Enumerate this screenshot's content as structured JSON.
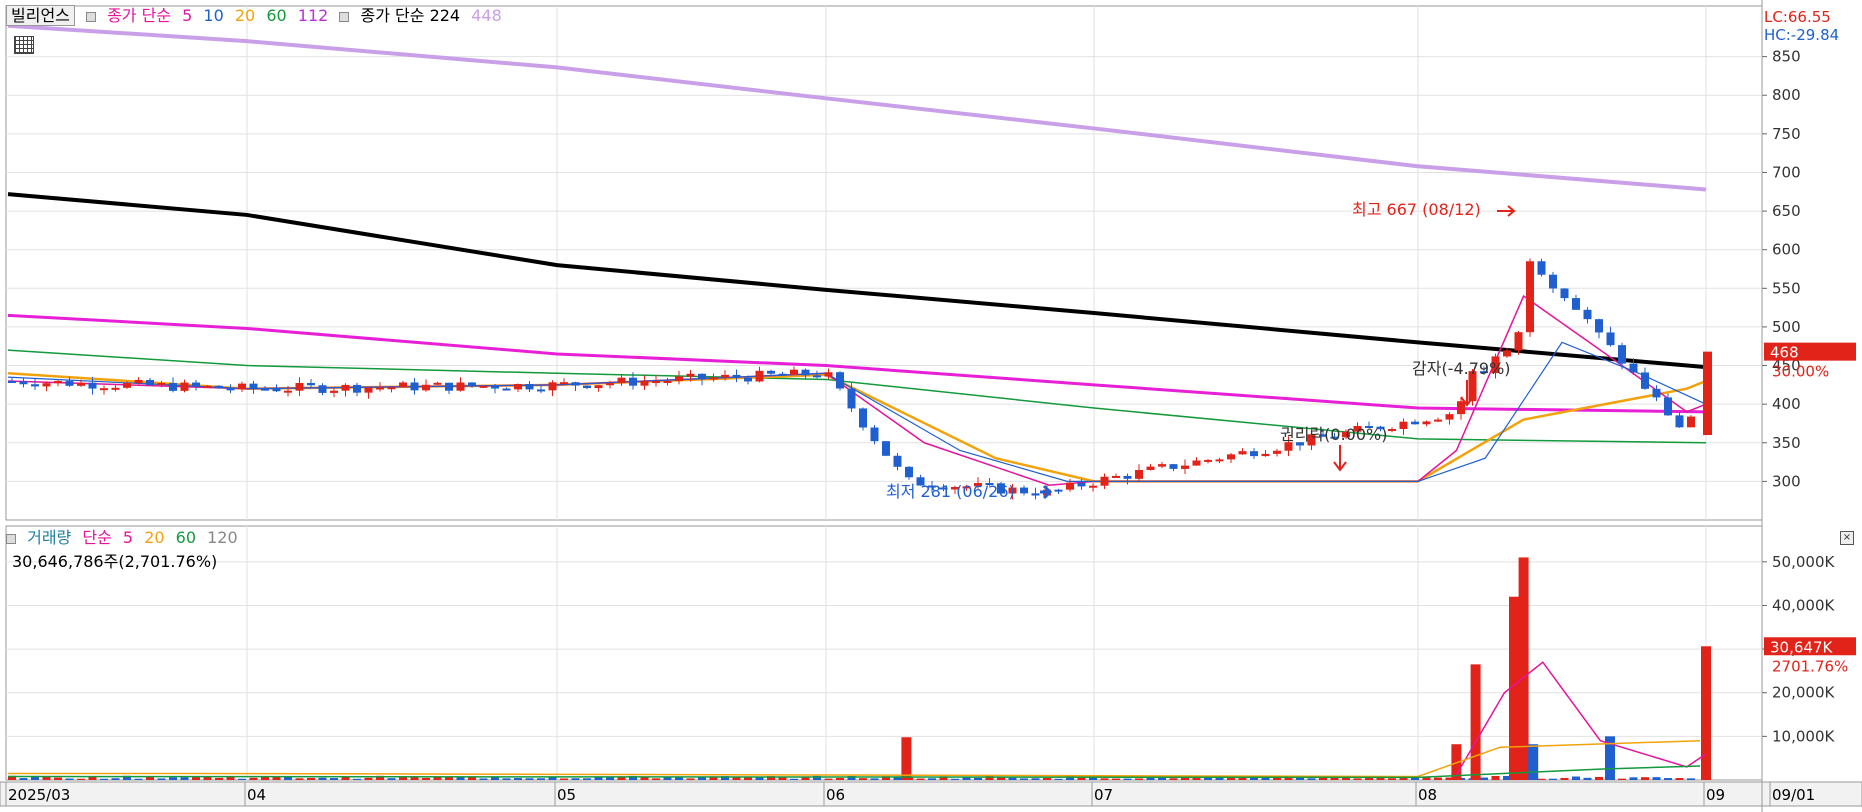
{
  "price_legend": {
    "tab": "빌리언스",
    "ma_title": "종가 단순",
    "ma_periods": [
      "5",
      "10",
      "20",
      "60",
      "112"
    ],
    "ma_colors": [
      "#e6149c",
      "#1f5fd0",
      "#f2a20c",
      "#129a3c",
      "#b832d8"
    ],
    "ma_long_title": "종가 단순 224",
    "ma_long_extra": "448",
    "ma_long_extra_color": "#c9a0e8"
  },
  "volume_legend": {
    "title": "거래량",
    "ma_title": "단순",
    "ma_periods": [
      "5",
      "20",
      "60",
      "120"
    ],
    "ma_colors": [
      "#e6149c",
      "#f2a20c",
      "#129a3c",
      "#888888"
    ],
    "info": "30,646,786주(2,701.76%)"
  },
  "corner": {
    "lc": "LC:66.55",
    "hc": "HC:-29.84"
  },
  "colors": {
    "up": "#e2231a",
    "down": "#1f5fd0",
    "ma224": "#000000",
    "ma448": "#c9a0e8"
  },
  "chart_data": [
    {
      "type": "candlestick",
      "ylim": [
        250,
        900
      ],
      "y_ticks": [
        300,
        350,
        400,
        450,
        500,
        550,
        600,
        650,
        700,
        750,
        800,
        850
      ],
      "x_ticks": [
        "2025/03",
        "04",
        "05",
        "06",
        "07",
        "08",
        "09",
        "09/01"
      ],
      "current_price": "468",
      "current_change": "30.00%",
      "annotations": {
        "high": "최고 667 (08/12)",
        "low": "최저 281 (06/26)",
        "rights": "권리락(0.00%)",
        "capital_reduction": "감자(-4.79%)"
      },
      "candles_key_points": [
        {
          "date": "2025/03",
          "close": 430
        },
        {
          "date": "04",
          "close": 420
        },
        {
          "date": "05",
          "close": 425
        },
        {
          "date": "06",
          "close": 440
        },
        {
          "date": "06/10",
          "open": 370,
          "close": 300
        },
        {
          "date": "06/26",
          "close": 285,
          "low": 281
        },
        {
          "date": "07",
          "close": 300
        },
        {
          "date": "08/05",
          "open": 300,
          "close": 390
        },
        {
          "date": "08/12",
          "close": 600,
          "high": 667
        },
        {
          "date": "08/29",
          "close": 360
        },
        {
          "date": "09/01",
          "open": 360,
          "close": 468
        }
      ],
      "ma224": [
        {
          "x": "2025/03",
          "y": 672
        },
        {
          "x": "04",
          "y": 645
        },
        {
          "x": "05",
          "y": 580
        },
        {
          "x": "06",
          "y": 548
        },
        {
          "x": "07",
          "y": 518
        },
        {
          "x": "08",
          "y": 480
        },
        {
          "x": "09",
          "y": 448
        }
      ],
      "ma448": [
        {
          "x": "2025/03",
          "y": 890
        },
        {
          "x": "04",
          "y": 870
        },
        {
          "x": "05",
          "y": 836
        },
        {
          "x": "06",
          "y": 796
        },
        {
          "x": "07",
          "y": 757
        },
        {
          "x": "08",
          "y": 708
        },
        {
          "x": "09",
          "y": 678
        }
      ],
      "ma112": [
        {
          "x": "2025/03",
          "y": 515
        },
        {
          "x": "04",
          "y": 498
        },
        {
          "x": "05",
          "y": 465
        },
        {
          "x": "06",
          "y": 450
        },
        {
          "x": "07",
          "y": 425
        },
        {
          "x": "08",
          "y": 395
        },
        {
          "x": "09",
          "y": 390
        }
      ],
      "ma60": [
        {
          "x": "2025/03",
          "y": 470
        },
        {
          "x": "04",
          "y": 450
        },
        {
          "x": "05",
          "y": 440
        },
        {
          "x": "06",
          "y": 432
        },
        {
          "x": "07",
          "y": 395
        },
        {
          "x": "08",
          "y": 355
        },
        {
          "x": "09",
          "y": 350
        }
      ]
    },
    {
      "type": "bar",
      "title": "거래량",
      "ylim": [
        0,
        55000
      ],
      "y_ticks": [
        "10,000K",
        "20,000K",
        "30,000K",
        "40,000K",
        "50,000K"
      ],
      "current_volume": "30,647K",
      "current_ratio": "2701.76%",
      "key_bars": [
        {
          "date": "06/10",
          "value": 9800
        },
        {
          "date": "08/05",
          "value": 8200
        },
        {
          "date": "08/07",
          "value": 26500
        },
        {
          "date": "08/11",
          "value": 42000
        },
        {
          "date": "08/12",
          "value": 51000
        },
        {
          "date": "08/13",
          "value": 8200
        },
        {
          "date": "08/21",
          "value": 10000
        },
        {
          "date": "09/01",
          "value": 30647
        }
      ]
    }
  ]
}
